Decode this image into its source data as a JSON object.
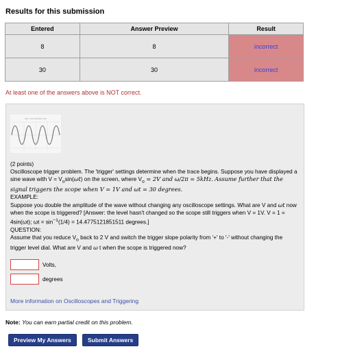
{
  "page_title": "Results for this submission",
  "table": {
    "headers": [
      "Entered",
      "Answer Preview",
      "Result"
    ],
    "rows": [
      {
        "entered": "8",
        "preview": "8",
        "result": "incorrect"
      },
      {
        "entered": "30",
        "preview": "30",
        "result": "incorrect"
      }
    ]
  },
  "warning": "At least one of the answers above is NOT correct.",
  "problem": {
    "thumbnail_caption": "Fab 1 and Induction Fitn",
    "points": "(2 points)",
    "intro": [
      "Oscilloscope trigger problem. The 'trigger' settings determine when the trace begins. Suppose you have displayed a sine wave with V = V",
      "o",
      "sin(",
      "ωt",
      ") on the screen, where V",
      "o",
      " = 2V and ω/2π = 5kHz.",
      "Assume further that the signal triggers the scope when V = 1V and ωt = 30 degrees."
    ],
    "example_label": "EXAMPLE:",
    "example": [
      "Suppose you double the amplitude of the wave without changing any oscilloscope settings. What are V and ",
      "ωt",
      " now when the scope is triggered? [Answer: the level hasn't changed so the scope still triggers when V = 1V.   V = 1 = 4sin(ωt);   ωt = sin",
      "−1",
      "(1/4) = 14.4775121851511 degrees.]"
    ],
    "question_label": "QUESTION:",
    "question": [
      "Assume that you reduce V",
      "o",
      " back to 2 V and switch the trigger slope polarity from '+' to '-' without changing the trigger level dial. What are V and ",
      "ω",
      " t when the scope is triggered now?"
    ],
    "answers": [
      {
        "unit_label": "Volts,",
        "value": ""
      },
      {
        "unit_label": "degrees",
        "value": ""
      }
    ],
    "more_info_link": "More information on Oscilloscopes and Triggering"
  },
  "note": {
    "label": "Note:",
    "text": "You can earn partial credit on this problem."
  },
  "buttons": {
    "preview": "Preview My Answers",
    "submit": "Submit Answers"
  },
  "colors": {
    "incorrect_cell": "#d9888a",
    "button": "#263e88",
    "link": "#3b4fa8",
    "warning": "#b03030"
  }
}
